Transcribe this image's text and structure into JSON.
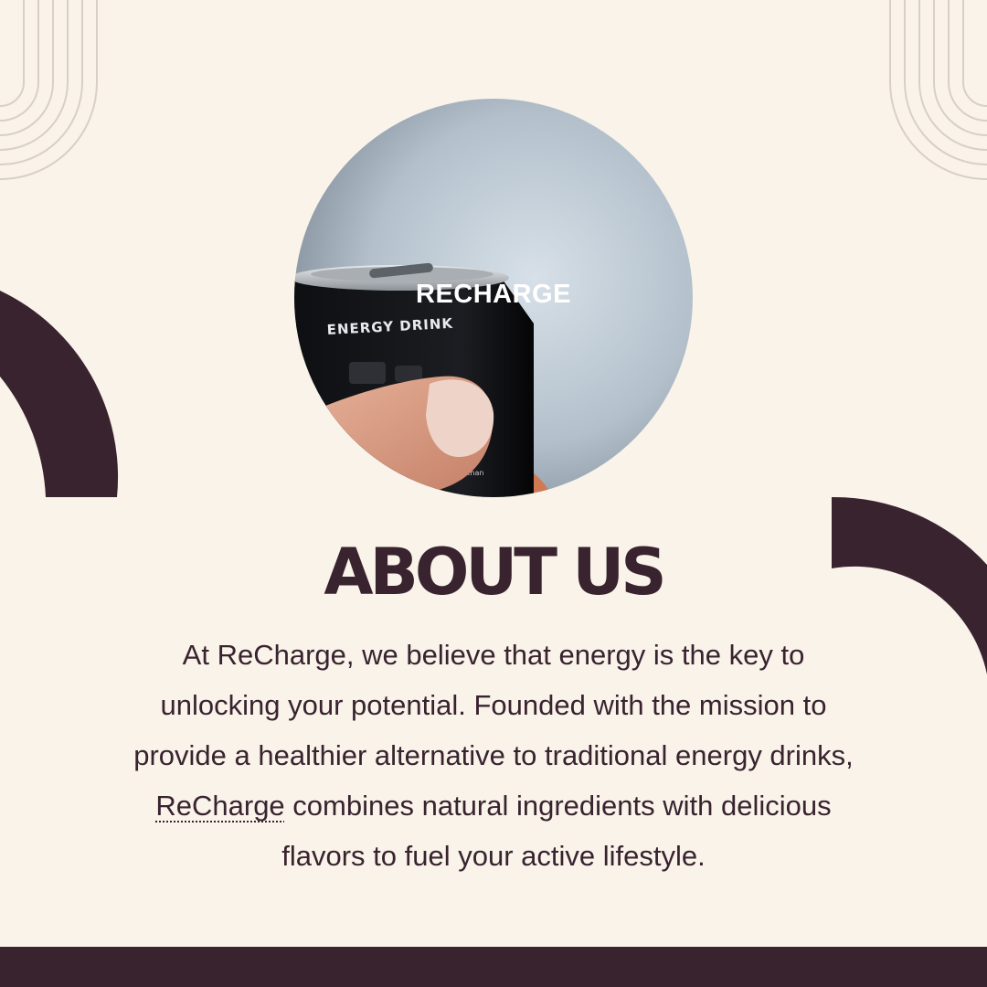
{
  "colors": {
    "background": "#faf3ea",
    "accent_dark": "#38232f",
    "line_art": "#d8d0c6"
  },
  "image": {
    "overlay_label": "RECHARGE",
    "can_text": "ENERGY DRINK"
  },
  "heading": "ABOUT US",
  "body": {
    "before": "At ReCharge, we believe that energy is the key to unlocking your potential. Founded with the mission to provide a healthier alternative to traditional energy drinks, ",
    "brand": "ReCharge",
    "after": " combines natural ingredients with delicious flavors to fuel your active lifestyle."
  }
}
